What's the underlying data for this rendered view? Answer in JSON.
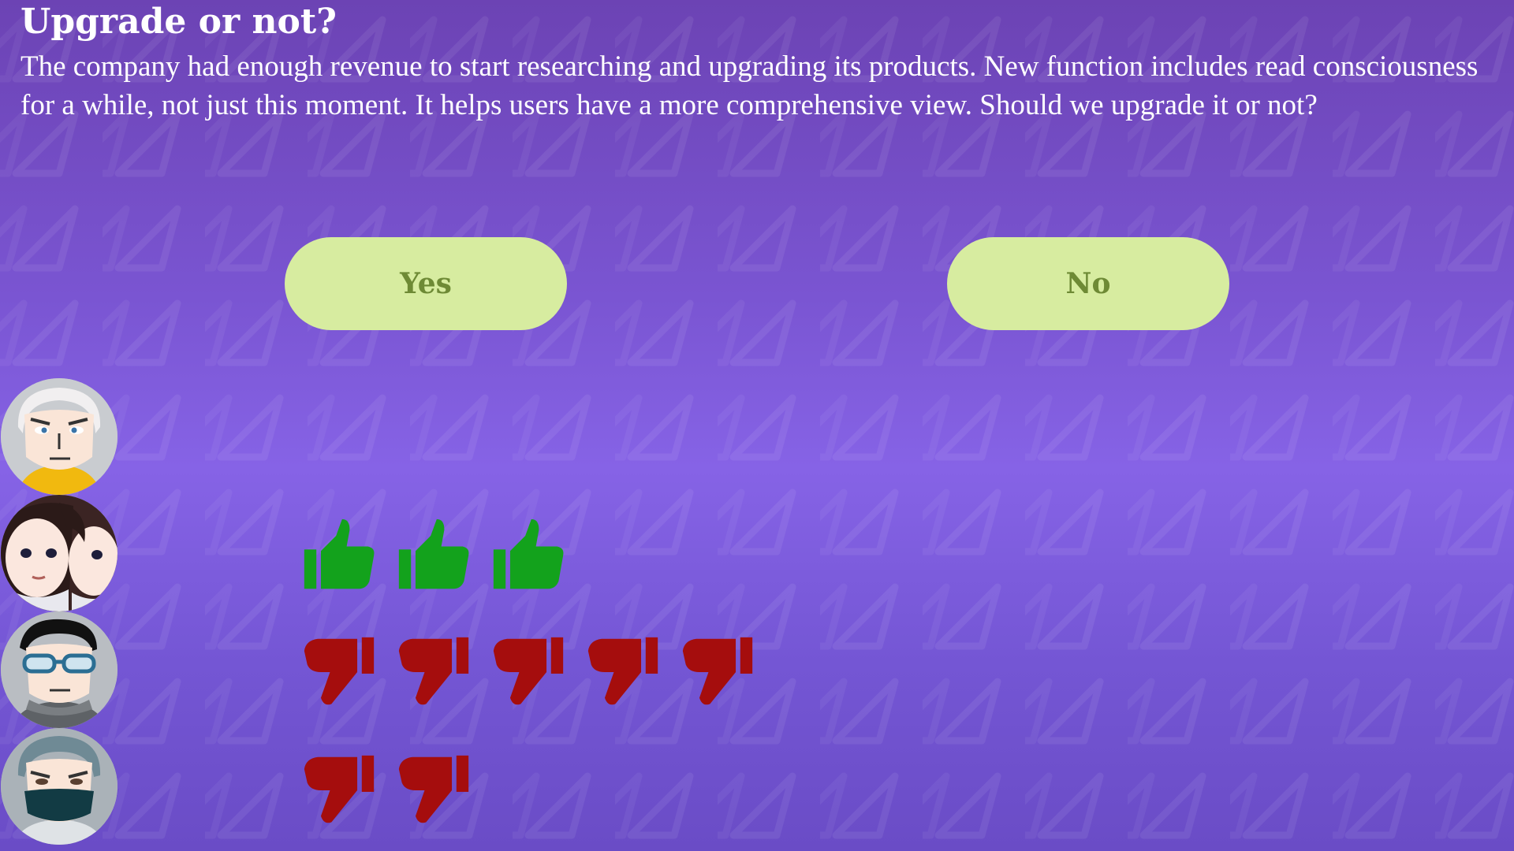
{
  "question": {
    "title": "Upgrade or not?",
    "body": "The company had enough revenue to start researching and upgrading its products. New function includes read consciousness for a while, not just this moment. It helps users have a more comprehensive view. Should we upgrade it or not?"
  },
  "choices": {
    "yes_label": "Yes",
    "no_label": "No"
  },
  "colors": {
    "button_bg": "#d7eca0",
    "button_text": "#6e8a35",
    "thumb_up": "#13a21c",
    "thumb_down": "#a50d0d"
  },
  "stakeholders": [
    {
      "icon": "bald-man-avatar-icon",
      "votes": []
    },
    {
      "icon": "twins-avatar-icon",
      "votes": [
        "up",
        "up",
        "up"
      ]
    },
    {
      "icon": "glasses-man-avatar-icon",
      "votes": [
        "down",
        "down",
        "down",
        "down",
        "down"
      ]
    },
    {
      "icon": "masked-woman-avatar-icon",
      "votes": [
        "down",
        "down"
      ]
    }
  ]
}
